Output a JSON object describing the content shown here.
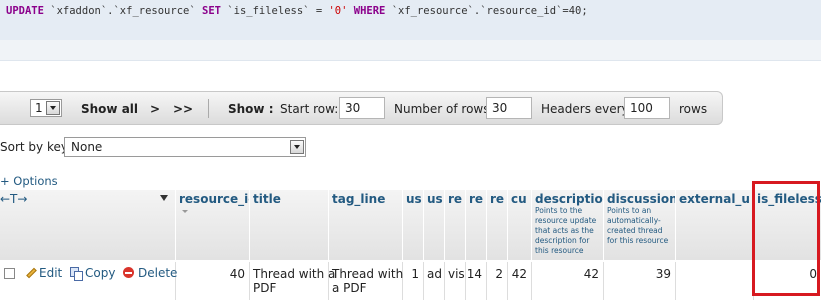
{
  "sql": {
    "kw_update": "UPDATE",
    "ident_db_table": "`xfaddon`.`xf_resource`",
    "kw_set": "SET",
    "ident_col": "`is_fileless`",
    "op_eq": "=",
    "str_val": "'0'",
    "kw_where": "WHERE",
    "ident_where": "`xf_resource`.`resource_id`",
    "where_tail": "=40;"
  },
  "nav": {
    "page_select": "1",
    "show_all": "Show all",
    "next": ">",
    "last": ">>",
    "show_label": "Show :",
    "start_row_label": "Start row:",
    "start_row_value": "30",
    "num_rows_label": "Number of rows:",
    "num_rows_value": "30",
    "headers_every_label": "Headers every",
    "headers_every_value": "100",
    "rows_suffix": "rows"
  },
  "sort": {
    "label": "Sort by key:",
    "selected": "None"
  },
  "options_link": "+ Options",
  "table": {
    "ctrl_arrows": "←T→",
    "columns": [
      {
        "key": "resource_id",
        "label": "resource_id",
        "comment": ""
      },
      {
        "key": "title",
        "label": "title",
        "comment": ""
      },
      {
        "key": "tag_line",
        "label": "tag_line",
        "comment": ""
      },
      {
        "key": "us1",
        "label": "us",
        "comment": ""
      },
      {
        "key": "us2",
        "label": "us",
        "comment": ""
      },
      {
        "key": "re1",
        "label": "re",
        "comment": ""
      },
      {
        "key": "re2",
        "label": "re",
        "comment": ""
      },
      {
        "key": "re3",
        "label": "re",
        "comment": ""
      },
      {
        "key": "cu",
        "label": "cu",
        "comment": ""
      },
      {
        "key": "description_",
        "label": "description_",
        "comment": "Points to the resource update that acts as the description for this resource"
      },
      {
        "key": "discussion_",
        "label": "discussion_",
        "comment": "Points to an automatically-created thread for this resource"
      },
      {
        "key": "external_url",
        "label": "external_url",
        "comment": ""
      },
      {
        "key": "is_fileless",
        "label": "is_fileless",
        "comment": ""
      }
    ],
    "row": {
      "actions": {
        "edit": "Edit",
        "copy": "Copy",
        "delete": "Delete"
      },
      "resource_id": "40",
      "title": "Thread with a PDF",
      "title_line1": "Thread with a",
      "title_line2": "PDF",
      "tag_line_line1": "Thread with",
      "tag_line_line2": "a PDF",
      "us1": "1",
      "us2": "ad",
      "re1": "vis",
      "re2": "14",
      "re3": "2",
      "cu": "42",
      "description_": "42",
      "discussion_": "39",
      "external_url": "",
      "is_fileless": "0"
    }
  },
  "colors": {
    "link": "#235a81",
    "keyword": "#8b008b",
    "string": "#c00000",
    "highlight_box": "#d71920"
  }
}
